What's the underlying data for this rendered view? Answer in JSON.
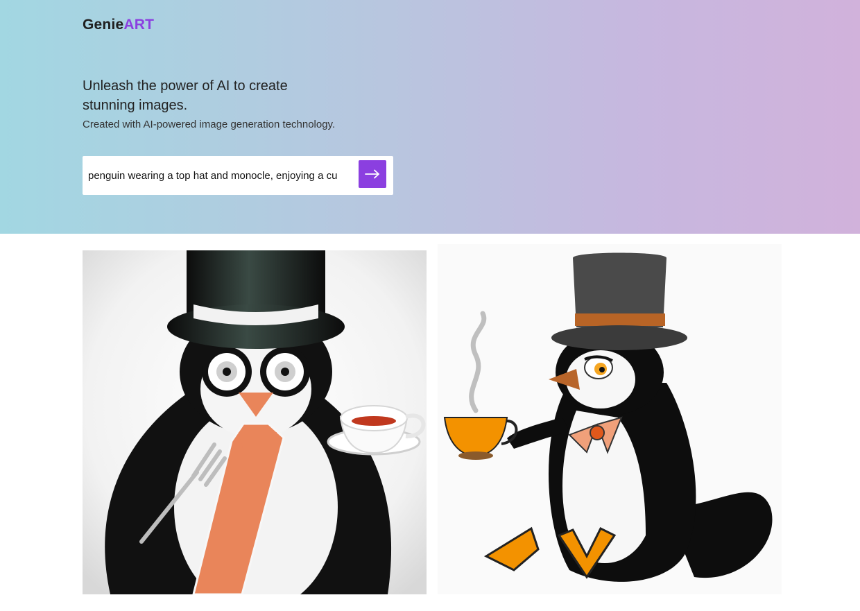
{
  "brand": {
    "name_primary": "Genie",
    "name_accent": "ART"
  },
  "hero": {
    "headline": "Unleash the power of AI to create stunning images.",
    "subheadline": "Created with AI-powered image generation technology."
  },
  "prompt": {
    "value": "penguin wearing a top hat and monocle, enjoying a cu",
    "submit_icon": "arrow-right-icon"
  },
  "colors": {
    "accent": "#8b3fe0",
    "gradient_start": "#a2d7e2",
    "gradient_end": "#d1b2db"
  },
  "gallery": {
    "images": [
      {
        "subject": "penguin-with-top-hat-monocle-tie-teacup-fork"
      },
      {
        "subject": "penguin-with-top-hat-bowtie-teacup"
      }
    ]
  }
}
